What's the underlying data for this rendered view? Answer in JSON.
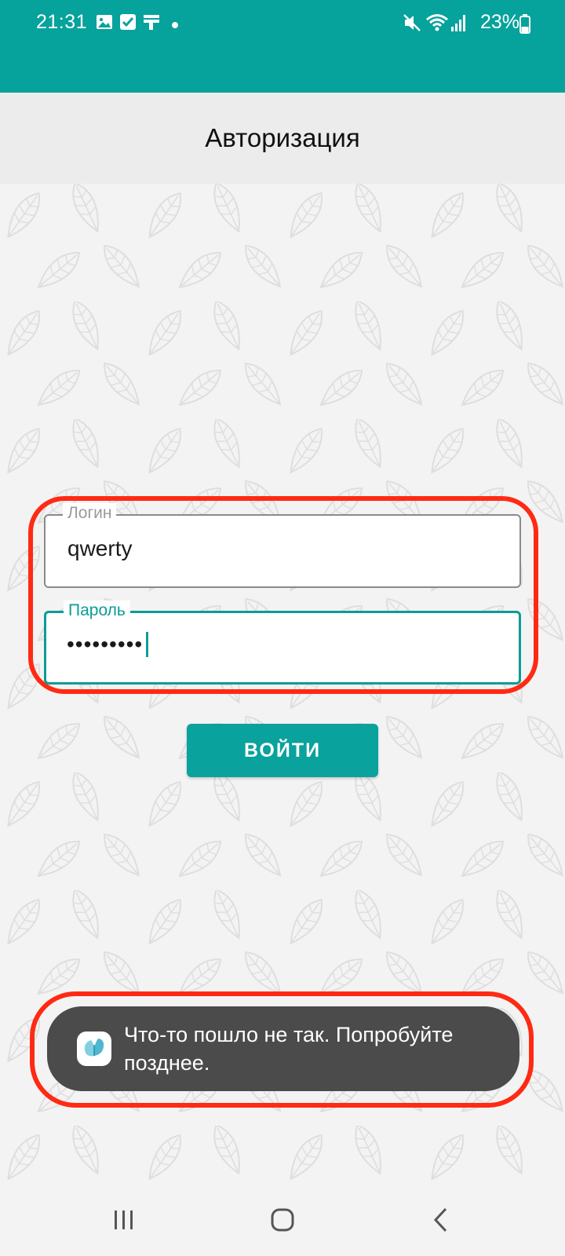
{
  "status_bar": {
    "time": "21:31",
    "battery": "23%",
    "left_icons": [
      "gallery-icon",
      "checkbox-icon",
      "message-icon",
      "notification-dot-icon"
    ],
    "right_icons": [
      "mute-icon",
      "wifi-icon",
      "signal-icon",
      "battery-icon"
    ],
    "background_color": "#06A29C"
  },
  "app_bar": {
    "title": "Авторизация"
  },
  "form": {
    "login": {
      "label": "Логин",
      "value": "qwerty"
    },
    "password": {
      "label": "Пароль",
      "masked_value": "•••••••••"
    },
    "submit_label": "ВОЙТИ"
  },
  "toast": {
    "message": "Что-то пошло не так. Попробуйте позднее.",
    "icon": "app-butterfly-icon"
  },
  "nav_bar": {
    "icons": [
      "recent-apps-icon",
      "home-icon",
      "back-icon"
    ]
  },
  "colors": {
    "accent": "#0AA29C",
    "highlight": "#FF2A14",
    "toast_bg": "#4B4B4B"
  }
}
